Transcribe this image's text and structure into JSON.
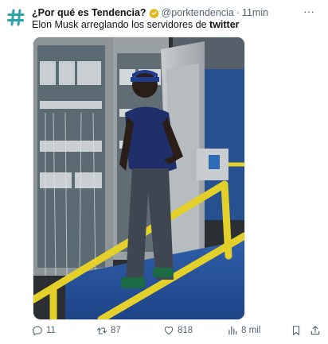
{
  "tweet": {
    "author_name": "¿Por qué es Tendencia?",
    "handle": "@porktendencia",
    "separator": "·",
    "time": "11min",
    "text_prefix": "Elon Musk arreglando los servidores de ",
    "text_bold": "twitter",
    "more_label": "···"
  },
  "actions": {
    "replies": "11",
    "retweets": "87",
    "likes": "818",
    "views": "8 mil"
  },
  "icons": {
    "avatar": "hashtag-logo-icon",
    "verified": "verified-check-icon",
    "reply": "reply-icon",
    "retweet": "retweet-icon",
    "like": "heart-icon",
    "views": "views-chart-icon",
    "bookmark": "bookmark-icon",
    "share": "share-icon"
  },
  "colors": {
    "brand_teal": "#2ba3a8",
    "verified_gold": "#e2b719",
    "text": "#0f1419",
    "secondary": "#536471"
  }
}
